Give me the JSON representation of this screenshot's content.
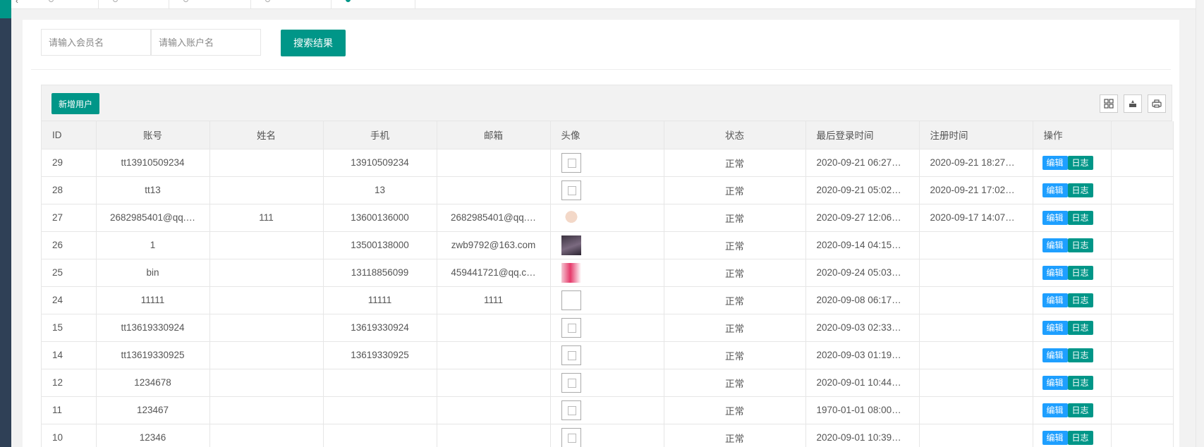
{
  "search": {
    "member_placeholder": "请输入会员名",
    "account_placeholder": "请输入账户名",
    "button_label": "搜索结果"
  },
  "toolbar": {
    "add_label": "新增用户",
    "icons": [
      "columns-icon",
      "export-icon",
      "print-icon"
    ]
  },
  "table": {
    "headers": {
      "id": "ID",
      "account": "账号",
      "name": "姓名",
      "phone": "手机",
      "email": "邮箱",
      "avatar": "头像",
      "status": "状态",
      "last_login": "最后登录时间",
      "register": "注册时间",
      "ops": "操作"
    },
    "edit_label": "编辑",
    "log_label": "日志",
    "rows": [
      {
        "id": "29",
        "account": "tt13910509234",
        "name": "",
        "phone": "13910509234",
        "email": "",
        "avatar": "broken",
        "status": "正常",
        "last_login": "2020-09-21 06:27…",
        "register": "2020-09-21 18:27…"
      },
      {
        "id": "28",
        "account": "tt13",
        "name": "",
        "phone": "13",
        "email": "",
        "avatar": "broken",
        "status": "正常",
        "last_login": "2020-09-21 05:02…",
        "register": "2020-09-21 17:02…"
      },
      {
        "id": "27",
        "account": "2682985401@qq.…",
        "name": "111",
        "phone": "13600136000",
        "email": "2682985401@qq.…",
        "avatar": "img1",
        "status": "正常",
        "last_login": "2020-09-27 12:06…",
        "register": "2020-09-17 14:07…"
      },
      {
        "id": "26",
        "account": "1",
        "name": "",
        "phone": "13500138000",
        "email": "zwb9792@163.com",
        "avatar": "img2",
        "status": "正常",
        "last_login": "2020-09-14 04:15…",
        "register": ""
      },
      {
        "id": "25",
        "account": "bin",
        "name": "",
        "phone": "13118856099",
        "email": "459441721@qq.c…",
        "avatar": "img3",
        "status": "正常",
        "last_login": "2020-09-24 05:03…",
        "register": ""
      },
      {
        "id": "24",
        "account": "11111",
        "name": "",
        "phone": "11111",
        "email": "1111",
        "avatar": "empty",
        "status": "正常",
        "last_login": "2020-09-08 06:17…",
        "register": ""
      },
      {
        "id": "15",
        "account": "tt13619330924",
        "name": "",
        "phone": "13619330924",
        "email": "",
        "avatar": "broken",
        "status": "正常",
        "last_login": "2020-09-03 02:33…",
        "register": ""
      },
      {
        "id": "14",
        "account": "tt13619330925",
        "name": "",
        "phone": "13619330925",
        "email": "",
        "avatar": "broken",
        "status": "正常",
        "last_login": "2020-09-03 01:19…",
        "register": ""
      },
      {
        "id": "12",
        "account": "1234678",
        "name": "",
        "phone": "",
        "email": "",
        "avatar": "broken",
        "status": "正常",
        "last_login": "2020-09-01 10:44…",
        "register": ""
      },
      {
        "id": "11",
        "account": "123467",
        "name": "",
        "phone": "",
        "email": "",
        "avatar": "broken",
        "status": "正常",
        "last_login": "1970-01-01 08:00…",
        "register": ""
      },
      {
        "id": "10",
        "account": "12346",
        "name": "",
        "phone": "",
        "email": "",
        "avatar": "broken",
        "status": "正常",
        "last_login": "2020-09-01 10:39…",
        "register": ""
      }
    ]
  }
}
